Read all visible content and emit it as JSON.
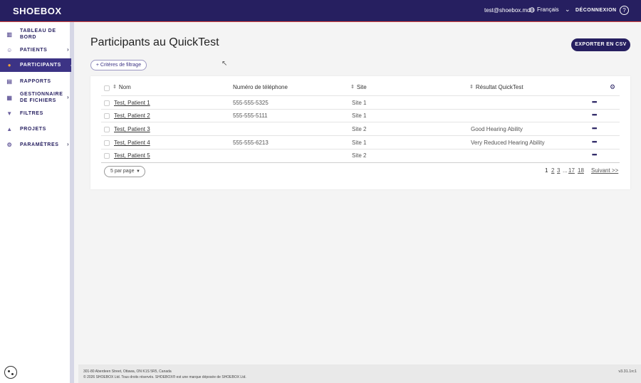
{
  "header": {
    "logo": "SHOEBOX",
    "user_email": "test@shoebox.md",
    "language": "Français",
    "logout": "DÉCONNEXION",
    "help": "?"
  },
  "sidebar": {
    "items": [
      {
        "label": "TABLEAU DE BORD",
        "icon": "bar-chart-icon",
        "chevron": false,
        "active": false
      },
      {
        "label": "PATIENTS",
        "icon": "patients-icon",
        "chevron": true,
        "active": false
      },
      {
        "label": "PARTICIPANTS",
        "icon": "participants-icon",
        "chevron": false,
        "active": true
      },
      {
        "label": "RAPPORTS",
        "icon": "report-icon",
        "chevron": false,
        "active": false
      },
      {
        "label": "GESTIONNAIRE DE FICHIERS",
        "icon": "files-icon",
        "chevron": true,
        "active": false
      },
      {
        "label": "FILTRES",
        "icon": "filter-icon",
        "chevron": false,
        "active": false
      },
      {
        "label": "PROJETS",
        "icon": "projects-icon",
        "chevron": false,
        "active": false
      },
      {
        "label": "PARAMÈTRES",
        "icon": "settings-gear-icon",
        "chevron": true,
        "active": false
      }
    ]
  },
  "main": {
    "title": "Participants au QuickTest",
    "export_label": "EXPORTER EN CSV",
    "filter_label": "+ Critères de filtrage",
    "table": {
      "columns": [
        "Nom",
        "Numéro de téléphone",
        "Site",
        "Résultat QuickTest"
      ],
      "rows": [
        {
          "name": "Test, Patient 1",
          "phone": "555-555-5325",
          "site": "Site 1",
          "result": ""
        },
        {
          "name": "Test, Patient 2",
          "phone": "555-555-5111",
          "site": "Site 1",
          "result": ""
        },
        {
          "name": "Test, Patient 3",
          "phone": "",
          "site": "Site 2",
          "result": "Good Hearing Ability"
        },
        {
          "name": "Test, Patient 4",
          "phone": "555-555-6213",
          "site": "Site 1",
          "result": "Very Reduced Hearing Ability"
        },
        {
          "name": "Test, Patient 5",
          "phone": "",
          "site": "Site 2",
          "result": ""
        }
      ]
    },
    "per_page": "5 par page",
    "pagination": {
      "pages": [
        "1",
        "2",
        "3"
      ],
      "ellipsis": "...",
      "last_pages": [
        "17",
        "18"
      ],
      "next": "Suivant >>"
    }
  },
  "footer": {
    "address": "301-80 Aberdeen Street, Ottawa, ON K1S 5R5, Canada",
    "copyright": "© 2026 SHOEBOX Ltd. Tous droits réservés. SHOEBOX® est une marque déposée de SHOEBOX Ltd.",
    "version": "v3.31.1rc1"
  },
  "colors": {
    "brand": "#261f60",
    "active_nav": "#3c3385",
    "accent": "#f0a23a",
    "header_border": "#e0483e"
  }
}
